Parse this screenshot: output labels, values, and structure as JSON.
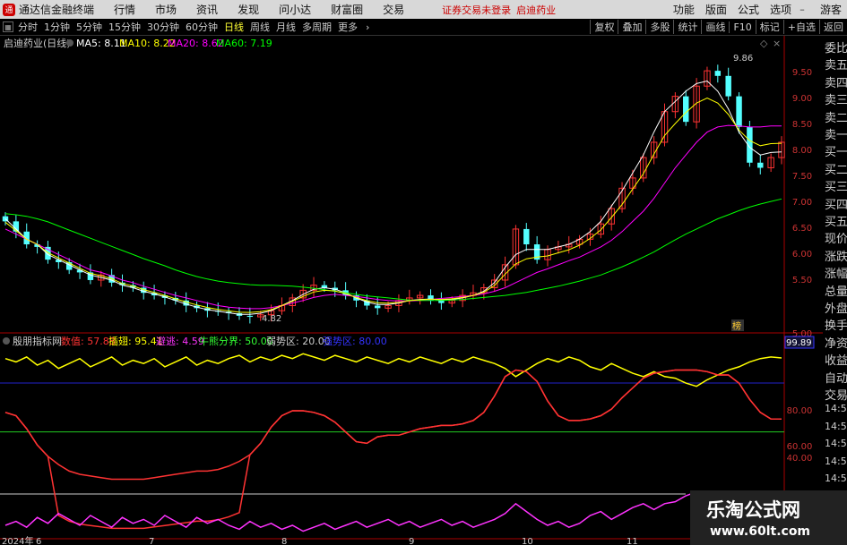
{
  "app": {
    "title": "通达信金融终端",
    "logo_text": "通"
  },
  "menu": [
    "行情",
    "市场",
    "资讯",
    "发现",
    "问小达",
    "财富圈",
    "交易"
  ],
  "notice": {
    "login": "证券交易未登录",
    "stock": "启迪药业"
  },
  "top_right": [
    "功能",
    "版面",
    "公式",
    "选项",
    "游客"
  ],
  "periods": [
    "分时",
    "1分钟",
    "5分钟",
    "15分钟",
    "30分钟",
    "60分钟",
    "日线",
    "周线",
    "月线",
    "多周期",
    "更多"
  ],
  "active_period": "日线",
  "right_buttons": [
    "复权",
    "叠加",
    "多股",
    "统计",
    "画线",
    "F10",
    "标记",
    "+自选",
    "返回"
  ],
  "main_chart": {
    "stock_title": "启迪药业(日线)",
    "ma": [
      {
        "label": "MA5: 8.11",
        "color": "#ffffff"
      },
      {
        "label": "MA10: 8.22",
        "color": "#ffff00"
      },
      {
        "label": "MA20: 8.62",
        "color": "#ff00ff"
      },
      {
        "label": "MA60: 7.19",
        "color": "#00ff00"
      }
    ],
    "high_label": "9.86",
    "low_label": "4.82",
    "price_axis": [
      "9.50",
      "9.00",
      "8.50",
      "8.00",
      "7.50",
      "7.00",
      "6.50",
      "6.00",
      "5.50",
      "5.00"
    ],
    "badge": "榜"
  },
  "indicator": {
    "name": "殷朋指标网",
    "items": [
      {
        "label": "数值: 57.88",
        "color": "#ff3333"
      },
      {
        "label": "插翅: 95.41",
        "color": "#ffff00"
      },
      {
        "label": "避逃: 4.59",
        "color": "#ff33ff"
      },
      {
        "label": "牛熊分界: 50.00",
        "color": "#33ff33"
      },
      {
        "label": "弱势区: 20.00",
        "color": "#cccccc"
      },
      {
        "label": "强势区: 80.00",
        "color": "#3333ff"
      }
    ],
    "axis": [
      "99.89",
      "80.00",
      "60.00",
      "40.00"
    ]
  },
  "date_axis": [
    "2024年",
    "6",
    "7",
    "8",
    "9",
    "10",
    "11"
  ],
  "side_panel": [
    "委比",
    "卖五",
    "卖四",
    "卖三",
    "卖二",
    "卖一",
    "买一",
    "买二",
    "买三",
    "买四",
    "买五",
    "现价",
    "涨跌",
    "涨幅",
    "总量",
    "外盘",
    "换手",
    "净资",
    "收益",
    "自动",
    "交易",
    "14:55",
    "14:55",
    "14:56",
    "14:56",
    "14:56",
    "14:56",
    "14:56",
    "14:56"
  ],
  "watermark": {
    "line1": "乐淘公式网",
    "line2": "www.60lt.com"
  },
  "chart_data": [
    {
      "type": "candlestick",
      "title": "启迪药业(日线)",
      "ylim": [
        4.6,
        10.0
      ],
      "series": [
        {
          "name": "MA5",
          "color": "#ffffff"
        },
        {
          "name": "MA10",
          "color": "#ffff00"
        },
        {
          "name": "MA20",
          "color": "#ff00ff"
        },
        {
          "name": "MA60",
          "color": "#00ff00"
        }
      ],
      "x": [
        "2024年",
        "6",
        "7",
        "8",
        "9",
        "10",
        "11"
      ],
      "close": [
        6.75,
        6.55,
        6.3,
        6.25,
        6.0,
        5.95,
        5.8,
        5.75,
        5.6,
        5.7,
        5.55,
        5.5,
        5.45,
        5.35,
        5.3,
        5.25,
        5.2,
        5.1,
        5.05,
        5.0,
        4.98,
        4.95,
        4.9,
        4.88,
        4.92,
        5.0,
        5.1,
        5.25,
        5.4,
        5.5,
        5.45,
        5.4,
        5.3,
        5.2,
        5.1,
        5.05,
        5.1,
        5.2,
        5.25,
        5.3,
        5.2,
        5.15,
        5.2,
        5.3,
        5.35,
        5.45,
        5.6,
        5.9,
        6.6,
        6.3,
        6.0,
        6.2,
        6.25,
        6.3,
        6.4,
        6.5,
        6.7,
        7.0,
        7.4,
        7.6,
        8.0,
        8.3,
        8.9,
        9.2,
        8.7,
        9.4,
        9.7,
        9.6,
        9.2,
        8.6,
        7.9,
        7.8,
        8.0,
        8.3
      ],
      "ma5": [
        6.8,
        6.6,
        6.4,
        6.3,
        6.1,
        6.0,
        5.9,
        5.8,
        5.7,
        5.65,
        5.6,
        5.5,
        5.45,
        5.38,
        5.33,
        5.27,
        5.2,
        5.13,
        5.07,
        5.02,
        4.99,
        4.96,
        4.93,
        4.93,
        4.95,
        5.0,
        5.1,
        5.2,
        5.32,
        5.42,
        5.45,
        5.42,
        5.35,
        5.25,
        5.17,
        5.12,
        5.12,
        5.15,
        5.2,
        5.22,
        5.23,
        5.21,
        5.22,
        5.25,
        5.3,
        5.38,
        5.55,
        5.85,
        6.1,
        6.2,
        6.2,
        6.2,
        6.25,
        6.3,
        6.4,
        6.55,
        6.75,
        7.05,
        7.35,
        7.7,
        8.05,
        8.5,
        8.9,
        9.1,
        9.3,
        9.45,
        9.5,
        9.3,
        8.95,
        8.5,
        8.2,
        8.05,
        8.1,
        8.11
      ],
      "ma20": [
        6.6,
        6.5,
        6.4,
        6.3,
        6.2,
        6.1,
        6.0,
        5.9,
        5.8,
        5.75,
        5.68,
        5.6,
        5.55,
        5.48,
        5.42,
        5.36,
        5.3,
        5.25,
        5.2,
        5.15,
        5.1,
        5.07,
        5.05,
        5.04,
        5.04,
        5.06,
        5.1,
        5.15,
        5.2,
        5.26,
        5.3,
        5.32,
        5.3,
        5.28,
        5.25,
        5.22,
        5.2,
        5.19,
        5.19,
        5.2,
        5.22,
        5.24,
        5.26,
        5.28,
        5.3,
        5.33,
        5.38,
        5.45,
        5.55,
        5.65,
        5.75,
        5.82,
        5.9,
        5.98,
        6.05,
        6.15,
        6.25,
        6.38,
        6.55,
        6.75,
        6.95,
        7.2,
        7.5,
        7.8,
        8.05,
        8.3,
        8.5,
        8.6,
        8.63,
        8.62,
        8.6,
        8.6,
        8.62,
        8.62
      ],
      "ma60": [
        6.9,
        6.88,
        6.85,
        6.8,
        6.74,
        6.66,
        6.58,
        6.5,
        6.42,
        6.34,
        6.26,
        6.18,
        6.1,
        6.02,
        5.95,
        5.88,
        5.8,
        5.73,
        5.67,
        5.62,
        5.58,
        5.55,
        5.53,
        5.51,
        5.5,
        5.5,
        5.49,
        5.48,
        5.46,
        5.44,
        5.41,
        5.38,
        5.35,
        5.32,
        5.29,
        5.27,
        5.25,
        5.23,
        5.21,
        5.2,
        5.2,
        5.2,
        5.21,
        5.22,
        5.24,
        5.26,
        5.28,
        5.3,
        5.33,
        5.36,
        5.4,
        5.44,
        5.48,
        5.53,
        5.58,
        5.64,
        5.7,
        5.78,
        5.86,
        5.95,
        6.05,
        6.15,
        6.27,
        6.39,
        6.5,
        6.6,
        6.7,
        6.8,
        6.88,
        6.96,
        7.03,
        7.09,
        7.14,
        7.19
      ]
    },
    {
      "type": "line",
      "title": "殷朋指标网",
      "ylim": [
        35,
        102
      ],
      "series": [
        {
          "name": "数值",
          "color": "#ff3333",
          "values": [
            62,
            60,
            52,
            42,
            35,
            30,
            26,
            24,
            23,
            22,
            21,
            21,
            21,
            21,
            22,
            23,
            24,
            25,
            26,
            26,
            27,
            29,
            32,
            36,
            43,
            53,
            60,
            63,
            63,
            62,
            60,
            56,
            50,
            44,
            43,
            47,
            48,
            48,
            50,
            52,
            53,
            54,
            54,
            55,
            57,
            62,
            72,
            84,
            88,
            87,
            81,
            69,
            60,
            57,
            57,
            58,
            60,
            64,
            71,
            77,
            83,
            86,
            87,
            88,
            88,
            88,
            87,
            85,
            85,
            80,
            70,
            62,
            58,
            57.88
          ]
        },
        {
          "name": "插翅",
          "color": "#ffff00",
          "values": [
            95,
            93,
            96,
            91,
            94,
            89,
            92,
            95,
            90,
            93,
            96,
            91,
            94,
            92,
            95,
            90,
            93,
            96,
            91,
            94,
            92,
            95,
            97,
            93,
            96,
            94,
            97,
            95,
            98,
            96,
            94,
            97,
            95,
            93,
            96,
            94,
            92,
            95,
            93,
            96,
            94,
            92,
            95,
            93,
            96,
            94,
            92,
            89,
            84,
            88,
            92,
            95,
            93,
            96,
            94,
            90,
            88,
            92,
            89,
            86,
            84,
            87,
            84,
            83,
            80,
            78,
            82,
            85,
            88,
            90,
            93,
            95,
            96,
            95.41
          ]
        },
        {
          "name": "避逃",
          "color": "#ff33ff",
          "values": [
            5,
            7,
            4,
            9,
            6,
            11,
            8,
            5,
            10,
            7,
            4,
            9,
            6,
            8,
            5,
            10,
            7,
            4,
            9,
            6,
            8,
            5,
            3,
            7,
            4,
            6,
            3,
            5,
            2,
            4,
            6,
            3,
            5,
            7,
            4,
            6,
            8,
            5,
            7,
            4,
            6,
            8,
            5,
            7,
            4,
            6,
            8,
            11,
            16,
            12,
            8,
            5,
            7,
            4,
            6,
            10,
            12,
            8,
            11,
            14,
            16,
            13,
            16,
            17,
            20,
            22,
            18,
            15,
            12,
            10,
            7,
            5,
            4,
            4.59
          ]
        }
      ],
      "levels": [
        {
          "name": "牛熊分界",
          "value": 50
        },
        {
          "name": "弱势区",
          "value": 20
        },
        {
          "name": "强势区",
          "value": 80
        }
      ]
    }
  ]
}
